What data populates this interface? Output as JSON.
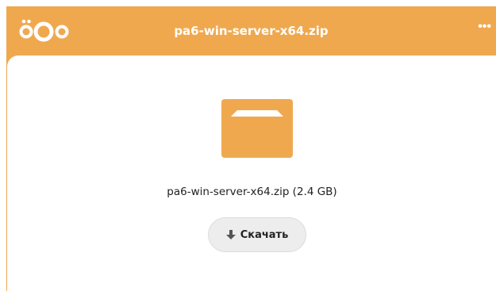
{
  "header": {
    "title": "pa6-win-server-x64.zip",
    "menu_label": "•••",
    "background_color": "#f0a84f"
  },
  "logo": {
    "icon": "nextcloud-logo-icon"
  },
  "file": {
    "icon": "folder-icon",
    "label": "pa6-win-server-x64.zip (2.4 GB)"
  },
  "download": {
    "icon": "download-arrow-icon",
    "label": "Скачать"
  }
}
